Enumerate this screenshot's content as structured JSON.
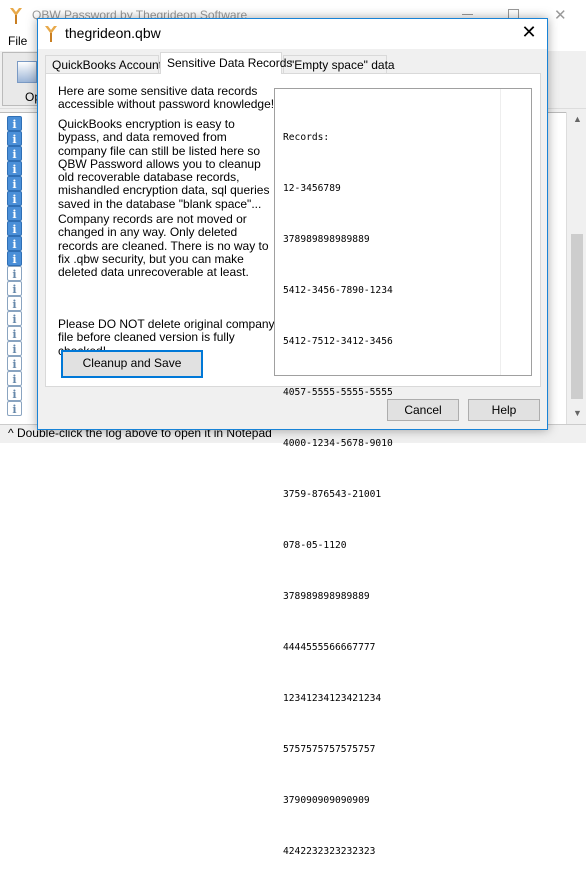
{
  "main_window": {
    "title": "QBW Password by Thegrideon Software",
    "menu": {
      "file": "File"
    },
    "toolbar": {
      "open_label": "Op"
    },
    "log_icons": [
      "blue",
      "blue",
      "blue",
      "blue",
      "blue",
      "blue",
      "blue",
      "blue",
      "blue",
      "blue",
      "white",
      "white",
      "white",
      "white",
      "white",
      "white",
      "white",
      "white",
      "white",
      "white"
    ],
    "status_text": "^ Double-click the log above to open it in Notepad"
  },
  "dialog": {
    "title": "thegrideon.qbw",
    "close_glyph": "✕",
    "tabs": [
      {
        "label": "QuickBooks Accounts"
      },
      {
        "label": "Sensitive Data Records"
      },
      {
        "label": "\"Empty space\" data"
      }
    ],
    "active_tab": 1,
    "paragraphs": [
      "Here are some sensitive data records accessible without password knowledge!",
      "QuickBooks encryption is easy to bypass, and data removed from company file can still be listed here so QBW Password allows you to cleanup old recoverable database records, mishandled encryption data, sql queries saved in the database \"blank space\"...",
      "Company records are not moved or changed in any way. Only deleted records are cleaned. There is no way to fix .qbw security, but you can make deleted data unrecoverable at least.",
      "Please DO NOT delete original company file before cleaned version is fully checked!"
    ],
    "cleanup_button": "Cleanup and Save",
    "records_header": "Records:",
    "records": [
      "12-3456789",
      "378989898989889",
      "5412-3456-7890-1234",
      "5412-7512-3412-3456",
      "4057-5555-5555-5555",
      "4000-1234-5678-9010",
      "3759-876543-21001",
      "078-05-1120",
      "378989898989889",
      "4444555566667777",
      "12341234123421234",
      "5757575757575757",
      "379090909090909",
      "4242232323232323"
    ],
    "cancel_button": "Cancel",
    "help_button": "Help"
  }
}
